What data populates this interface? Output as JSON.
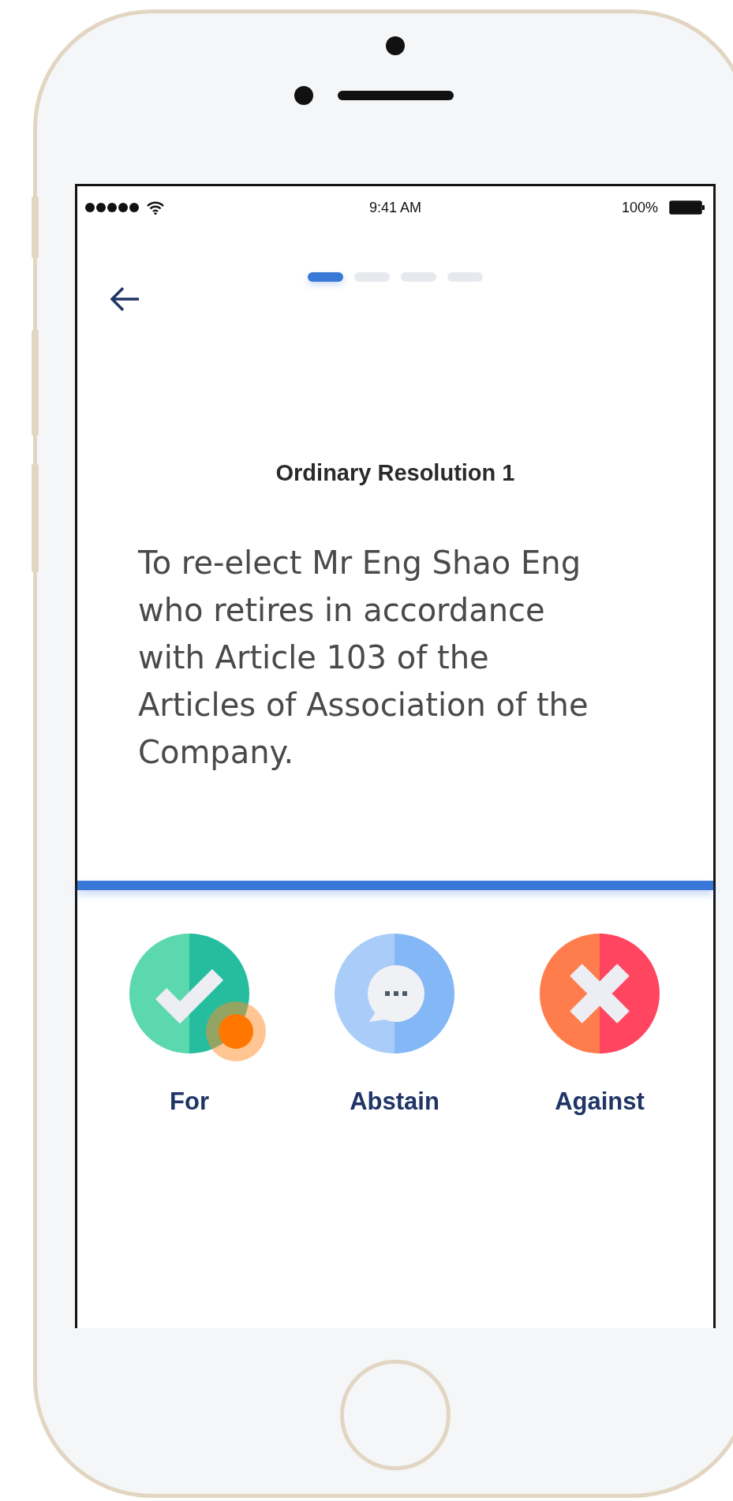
{
  "status_bar": {
    "time": "9:41 AM",
    "battery": "100%"
  },
  "step_indicator": {
    "steps": [
      {
        "selected": true
      },
      {
        "selected": false
      },
      {
        "selected": false
      },
      {
        "selected": false
      }
    ]
  },
  "resolution": {
    "title": "Ordinary Resolution 1",
    "text": "To re-elect Mr Eng Shao Eng\nwho retires in accordance\nwith Article 103 of the\nArticles of Association of the\nCompany."
  },
  "vote_options": [
    {
      "kind": "for",
      "label": "For",
      "touched": true
    },
    {
      "kind": "abstain",
      "label": "Abstain",
      "touched": false
    },
    {
      "kind": "against",
      "label": "Against",
      "touched": false
    }
  ]
}
